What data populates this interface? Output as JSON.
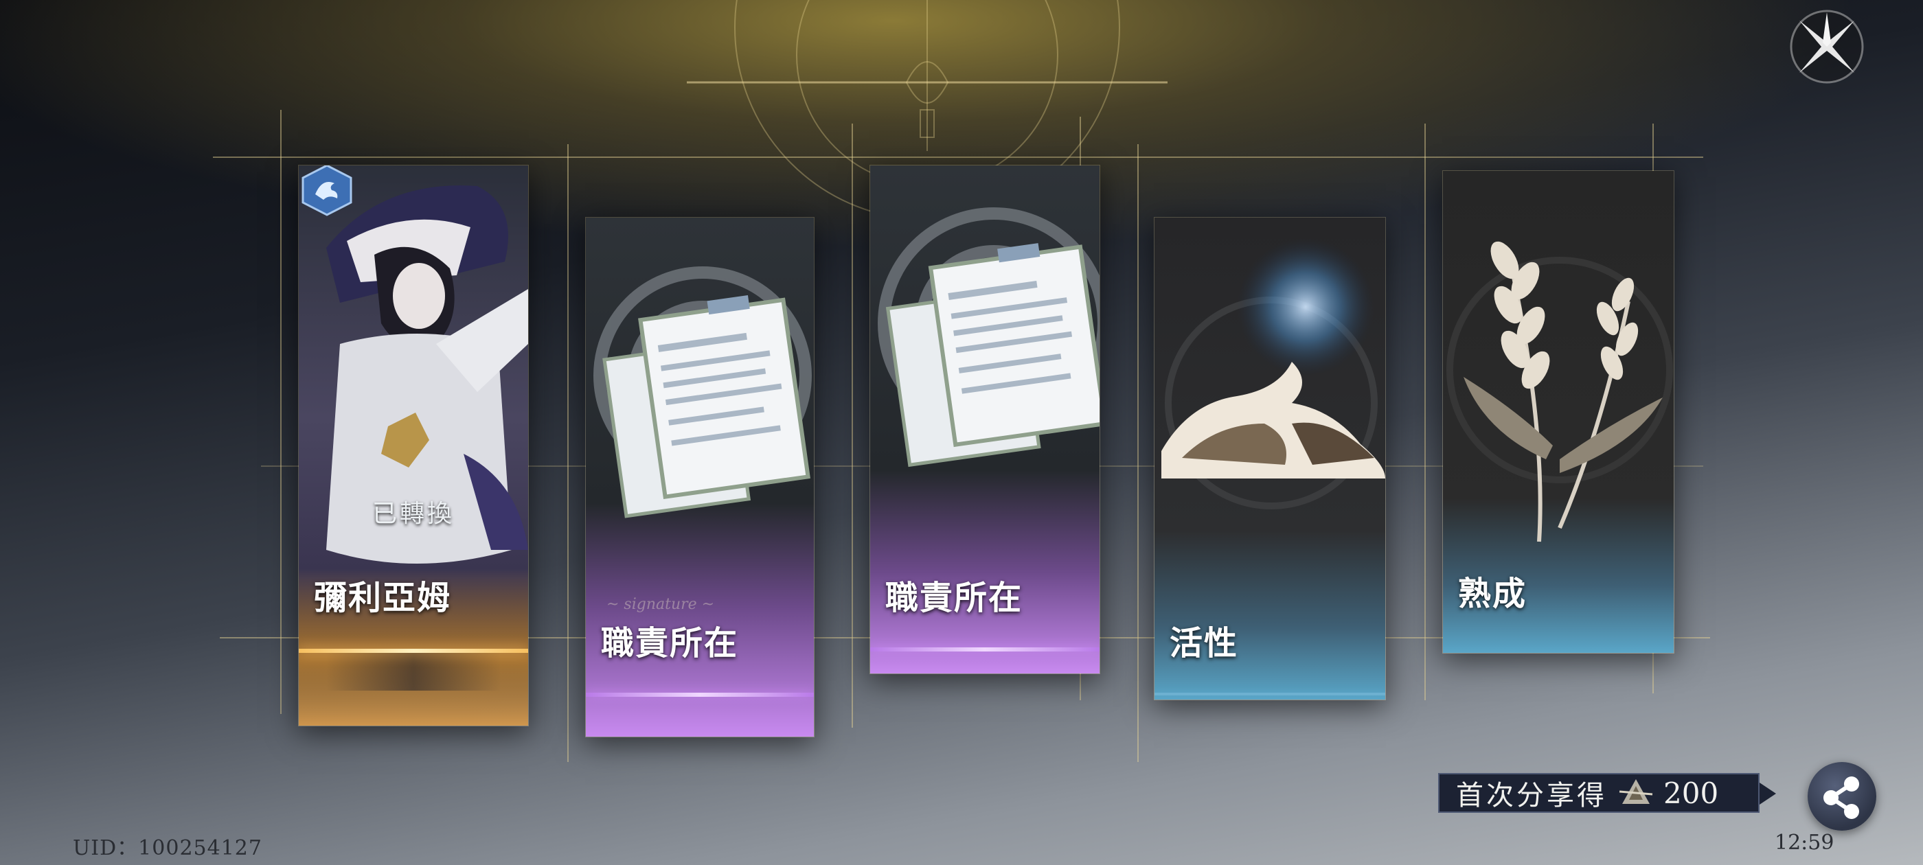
{
  "cards": [
    {
      "label": "彌利亞姆",
      "status": "已轉換",
      "accent": "#f0b45a"
    },
    {
      "label": "職責所在",
      "accent": "#c88af0"
    },
    {
      "label": "職責所在",
      "accent": "#c88af0"
    },
    {
      "label": "活性",
      "accent": "#5aa6c8"
    },
    {
      "label": "熟成",
      "accent": "#5aa6c8"
    }
  ],
  "share": {
    "reward_text": "首次分享得",
    "currency_icon": "crystal-icon",
    "reward_amount": "200"
  },
  "footer": {
    "uid": "UID：100254127",
    "time": "12:59"
  },
  "icons": {
    "close": "close-compass-icon",
    "share": "share-icon",
    "faction_badge": "dragon-badge-icon"
  }
}
